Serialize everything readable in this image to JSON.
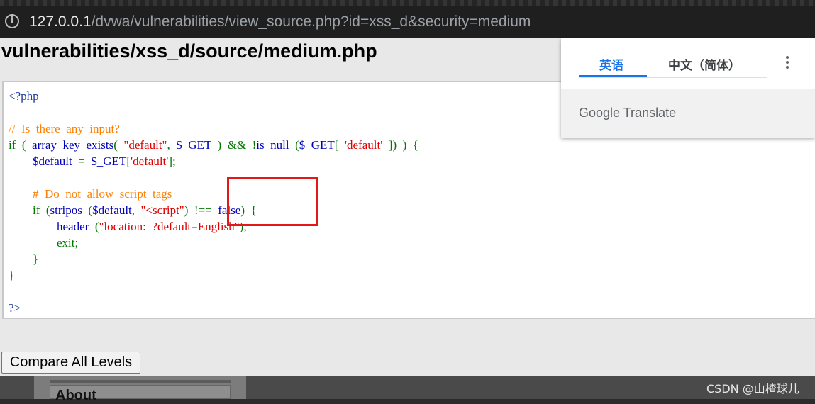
{
  "browser": {
    "url_host": "127.0.0.1",
    "url_path": "/dvwa/vulnerabilities/view_source.php?id=xss_d&security=medium"
  },
  "page": {
    "title": "vulnerabilities/xss_d/source/medium.php",
    "compare_button": "Compare All Levels"
  },
  "code_lines": [
    [
      {
        "c": "tag",
        "t": "<?php"
      }
    ],
    [],
    [
      {
        "c": "comment",
        "t": "//  Is  there  any  input?"
      }
    ],
    [
      {
        "c": "kw",
        "t": "if  (  "
      },
      {
        "c": "var",
        "t": "array_key_exists"
      },
      {
        "c": "kw",
        "t": "(  "
      },
      {
        "c": "str",
        "t": "\"default\""
      },
      {
        "c": "kw",
        "t": ",  "
      },
      {
        "c": "var",
        "t": "$_GET"
      },
      {
        "c": "kw",
        "t": "  )  &&  !"
      },
      {
        "c": "var",
        "t": "is_null"
      },
      {
        "c": "kw",
        "t": "  ("
      },
      {
        "c": "var",
        "t": "$_GET"
      },
      {
        "c": "kw",
        "t": "[  "
      },
      {
        "c": "str",
        "t": "'default'"
      },
      {
        "c": "kw",
        "t": "  ])  )  {"
      }
    ],
    [
      {
        "c": "kw",
        "t": "        "
      },
      {
        "c": "var",
        "t": "$default"
      },
      {
        "c": "kw",
        "t": "  =  "
      },
      {
        "c": "var",
        "t": "$_GET"
      },
      {
        "c": "kw",
        "t": "["
      },
      {
        "c": "str",
        "t": "'default'"
      },
      {
        "c": "kw",
        "t": "];"
      }
    ],
    [],
    [
      {
        "c": "comment",
        "t": "        #  Do  not  allow  script  tags"
      }
    ],
    [
      {
        "c": "kw",
        "t": "        if  ("
      },
      {
        "c": "var",
        "t": "stripos"
      },
      {
        "c": "kw",
        "t": "  ("
      },
      {
        "c": "var",
        "t": "$default"
      },
      {
        "c": "kw",
        "t": ",  "
      },
      {
        "c": "str",
        "t": "\"<script\""
      },
      {
        "c": "kw",
        "t": ")  !==  "
      },
      {
        "c": "var",
        "t": "false"
      },
      {
        "c": "kw",
        "t": ")  {"
      }
    ],
    [
      {
        "c": "kw",
        "t": "                "
      },
      {
        "c": "var",
        "t": "header"
      },
      {
        "c": "kw",
        "t": "  ("
      },
      {
        "c": "str",
        "t": "\"location:  ?default=English\""
      },
      {
        "c": "kw",
        "t": ");"
      }
    ],
    [
      {
        "c": "kw",
        "t": "                exit;"
      }
    ],
    [
      {
        "c": "kw",
        "t": "        }"
      }
    ],
    [
      {
        "c": "kw",
        "t": "}"
      }
    ],
    [],
    [
      {
        "c": "tag",
        "t": "?>"
      }
    ]
  ],
  "sidebar_menu": {
    "item_label": "About"
  },
  "translate_popup": {
    "tab_english": "英语",
    "tab_chinese": "中文（简体）",
    "logo_google": "Google",
    "logo_translate": "Translate"
  },
  "watermark": "CSDN @山楂球儿",
  "colors": {
    "highlight_box": "#e41818",
    "translate_accent": "#1a73e8"
  }
}
